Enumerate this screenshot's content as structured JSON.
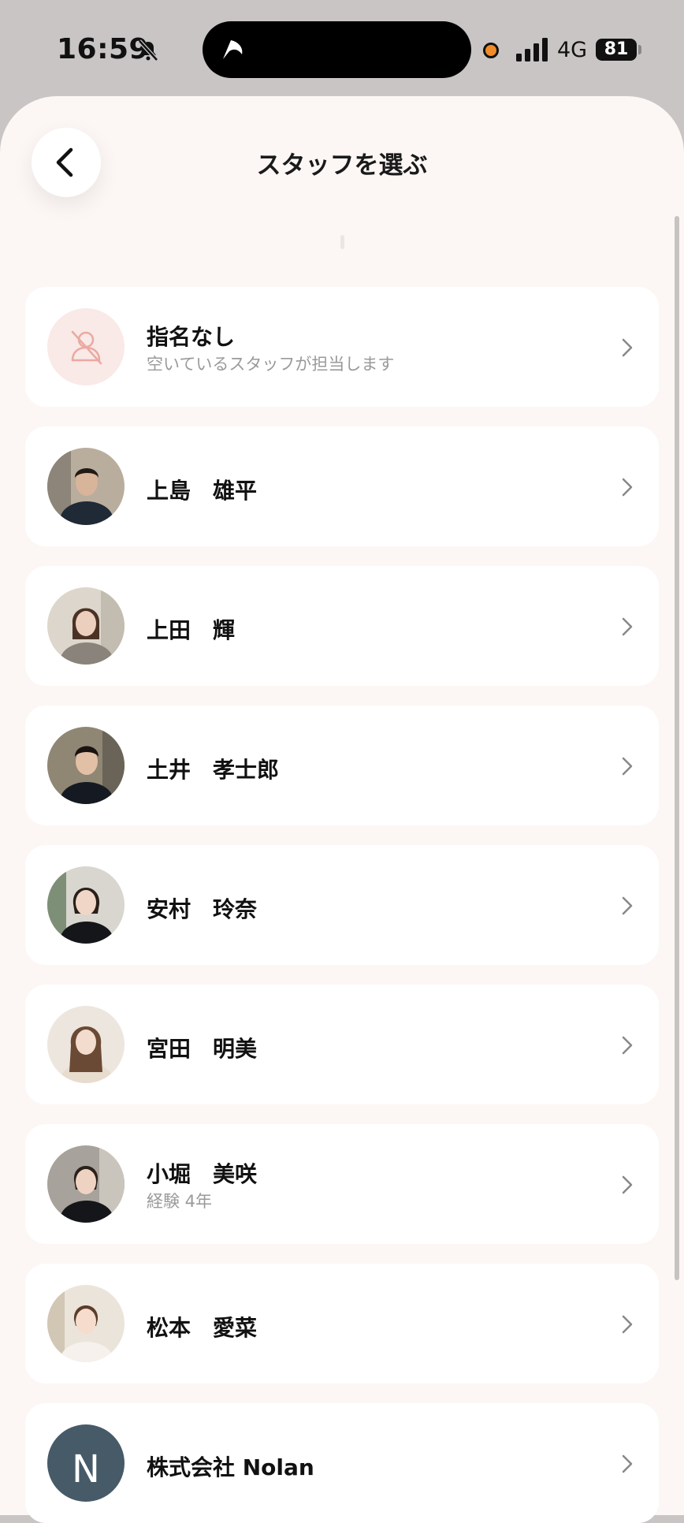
{
  "status_bar": {
    "time": "16:59",
    "network": "4G",
    "battery": "81"
  },
  "header": {
    "title": "スタッフを選ぶ"
  },
  "staff_list": [
    {
      "name": "指名なし",
      "subtitle": "空いているスタッフが担当します",
      "avatar": "no-preference-icon"
    },
    {
      "name": "上島　雄平",
      "subtitle": "",
      "avatar": "photo"
    },
    {
      "name": "上田　輝",
      "subtitle": "",
      "avatar": "photo"
    },
    {
      "name": "土井　孝士郎",
      "subtitle": "",
      "avatar": "photo"
    },
    {
      "name": "安村　玲奈",
      "subtitle": "",
      "avatar": "photo"
    },
    {
      "name": "宮田　明美",
      "subtitle": "",
      "avatar": "photo"
    },
    {
      "name": "小堀　美咲",
      "subtitle": "経験 4年",
      "avatar": "photo"
    },
    {
      "name": "松本　愛菜",
      "subtitle": "",
      "avatar": "photo"
    },
    {
      "name": "株式会社 Nolan",
      "subtitle": "",
      "avatar": "N"
    }
  ],
  "colors": {
    "sheet_bg": "#fcf7f5",
    "card_bg": "#ffffff",
    "no_pref_bg": "#f9e9e7",
    "no_pref_icon": "#eba9a2",
    "initial_avatar_bg": "#465a68"
  }
}
